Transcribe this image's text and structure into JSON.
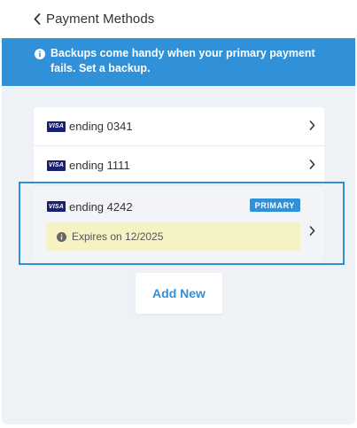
{
  "header": {
    "title": "Payment Methods",
    "back_icon": "chevron-left-icon"
  },
  "banner": {
    "message": "Backups come handy when your primary payment fails. Set a backup.",
    "icon": "info-icon",
    "color": "#3090d8"
  },
  "cards": [
    {
      "brand": "VISA",
      "label": "ending 0341"
    },
    {
      "brand": "VISA",
      "label": "ending 1111"
    }
  ],
  "selected_card": {
    "brand": "VISA",
    "label": "ending 4242",
    "badge": "PRIMARY",
    "expiry": "Expires on 12/2025"
  },
  "actions": {
    "add_new_label": "Add New"
  },
  "colors": {
    "accent": "#3090d8",
    "background": "#eef1f6",
    "expiry_bg": "#f5f2c4",
    "visa": "#1a1f71"
  }
}
